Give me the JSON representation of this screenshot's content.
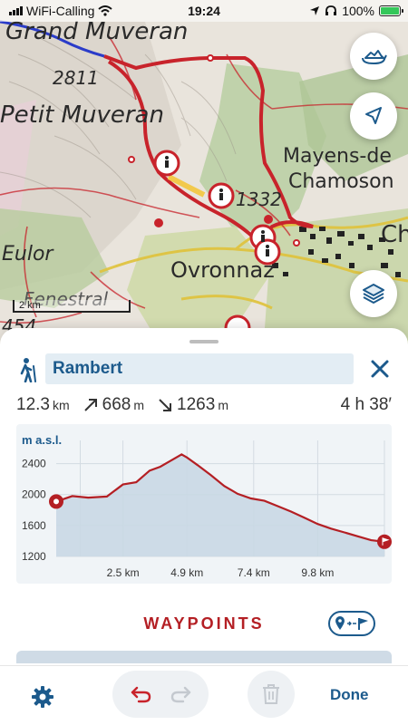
{
  "status_bar": {
    "carrier": "WiFi-Calling",
    "time": "19:24",
    "battery": "100%",
    "battery_level": 1.0
  },
  "map": {
    "labels": {
      "grand_muveran": "Grand Muveran",
      "petit_muveran": "Petit Muveran",
      "elev_2811": "2811",
      "mayens": "Mayens-de",
      "chamoson": "Chamoson",
      "ch": "Ch",
      "elev_1332": "1332",
      "eulor": "Eulor",
      "ovronnaz": "Ovronnaz",
      "fenestral": "Fenestral",
      "elev_454": "454"
    },
    "scale_label": "2 km",
    "colors": {
      "route": "#c8232b",
      "lake_blue": "#2b3cc9",
      "forest": "#a7c48b"
    },
    "buttons": {
      "rotate_3d": "rotate-3d-icon",
      "locate": "location-arrow-icon",
      "layers": "layers-icon"
    }
  },
  "route": {
    "name": "Rambert",
    "activity_icon": "hiker-icon",
    "distance": "12.3",
    "distance_unit": "km",
    "ascent": "668",
    "ascent_unit": "m",
    "descent": "1263",
    "descent_unit": "m",
    "duration": "4 h 38′"
  },
  "chart_data": {
    "type": "area",
    "ylabel": "m a.s.l.",
    "ylim": [
      1200,
      2700
    ],
    "y_ticks": [
      "2400",
      "2000",
      "1600",
      "1200"
    ],
    "y_tick_values": [
      2400,
      2000,
      1600,
      1200
    ],
    "x_tick_labels": [
      "2.5 km",
      "4.9 km",
      "7.4 km",
      "9.8 km"
    ],
    "x_tick_values": [
      2.5,
      4.9,
      7.4,
      9.8
    ],
    "xlim": [
      0,
      12.3
    ],
    "x": [
      0,
      0.6,
      1.2,
      1.9,
      2.5,
      3.0,
      3.5,
      3.9,
      4.3,
      4.7,
      4.9,
      5.3,
      5.8,
      6.3,
      6.8,
      7.3,
      7.8,
      8.3,
      8.8,
      9.3,
      9.8,
      10.3,
      10.8,
      11.3,
      11.8,
      12.3
    ],
    "y": [
      1910,
      1980,
      1960,
      1975,
      2130,
      2160,
      2310,
      2360,
      2440,
      2520,
      2480,
      2380,
      2250,
      2110,
      2010,
      1950,
      1920,
      1850,
      1780,
      1700,
      1620,
      1560,
      1510,
      1460,
      1410,
      1390
    ],
    "start_marker": "pin-icon",
    "end_marker": "flag-icon"
  },
  "waypoints": {
    "title": "WAYPOINTS",
    "toggle_icon": "pin-to-flag-icon"
  },
  "toolbar": {
    "settings_icon": "gear-icon",
    "undo_icon": "undo-icon",
    "redo_icon": "redo-icon",
    "delete_icon": "trash-icon",
    "done_label": "Done"
  }
}
